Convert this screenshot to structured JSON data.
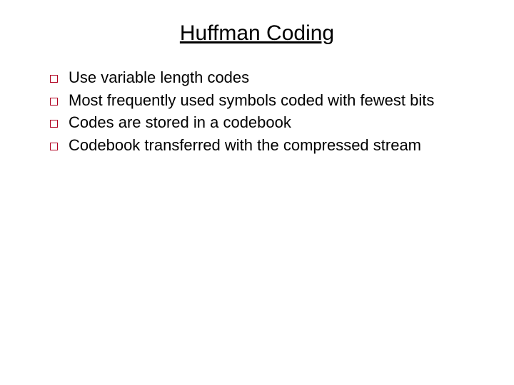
{
  "slide": {
    "title": "Huffman Coding",
    "bullets": [
      "Use variable length codes",
      "Most frequently used symbols coded with fewest bits",
      "Codes are stored in a codebook",
      "Codebook transferred with the compressed stream"
    ]
  },
  "colors": {
    "bullet_border": "#b00020"
  }
}
